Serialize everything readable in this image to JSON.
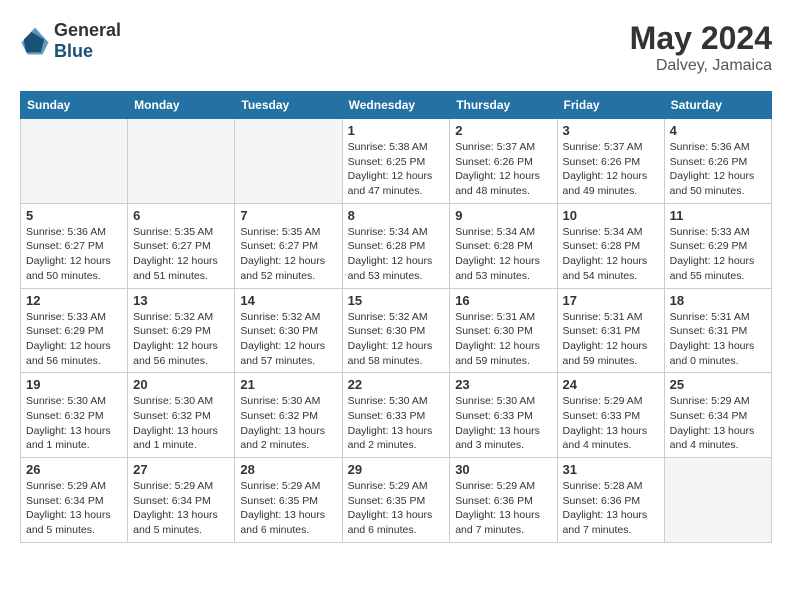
{
  "header": {
    "logo_general": "General",
    "logo_blue": "Blue",
    "month_year": "May 2024",
    "location": "Dalvey, Jamaica"
  },
  "weekdays": [
    "Sunday",
    "Monday",
    "Tuesday",
    "Wednesday",
    "Thursday",
    "Friday",
    "Saturday"
  ],
  "weeks": [
    [
      {
        "day": "",
        "info": ""
      },
      {
        "day": "",
        "info": ""
      },
      {
        "day": "",
        "info": ""
      },
      {
        "day": "1",
        "info": "Sunrise: 5:38 AM\nSunset: 6:25 PM\nDaylight: 12 hours\nand 47 minutes."
      },
      {
        "day": "2",
        "info": "Sunrise: 5:37 AM\nSunset: 6:26 PM\nDaylight: 12 hours\nand 48 minutes."
      },
      {
        "day": "3",
        "info": "Sunrise: 5:37 AM\nSunset: 6:26 PM\nDaylight: 12 hours\nand 49 minutes."
      },
      {
        "day": "4",
        "info": "Sunrise: 5:36 AM\nSunset: 6:26 PM\nDaylight: 12 hours\nand 50 minutes."
      }
    ],
    [
      {
        "day": "5",
        "info": "Sunrise: 5:36 AM\nSunset: 6:27 PM\nDaylight: 12 hours\nand 50 minutes."
      },
      {
        "day": "6",
        "info": "Sunrise: 5:35 AM\nSunset: 6:27 PM\nDaylight: 12 hours\nand 51 minutes."
      },
      {
        "day": "7",
        "info": "Sunrise: 5:35 AM\nSunset: 6:27 PM\nDaylight: 12 hours\nand 52 minutes."
      },
      {
        "day": "8",
        "info": "Sunrise: 5:34 AM\nSunset: 6:28 PM\nDaylight: 12 hours\nand 53 minutes."
      },
      {
        "day": "9",
        "info": "Sunrise: 5:34 AM\nSunset: 6:28 PM\nDaylight: 12 hours\nand 53 minutes."
      },
      {
        "day": "10",
        "info": "Sunrise: 5:34 AM\nSunset: 6:28 PM\nDaylight: 12 hours\nand 54 minutes."
      },
      {
        "day": "11",
        "info": "Sunrise: 5:33 AM\nSunset: 6:29 PM\nDaylight: 12 hours\nand 55 minutes."
      }
    ],
    [
      {
        "day": "12",
        "info": "Sunrise: 5:33 AM\nSunset: 6:29 PM\nDaylight: 12 hours\nand 56 minutes."
      },
      {
        "day": "13",
        "info": "Sunrise: 5:32 AM\nSunset: 6:29 PM\nDaylight: 12 hours\nand 56 minutes."
      },
      {
        "day": "14",
        "info": "Sunrise: 5:32 AM\nSunset: 6:30 PM\nDaylight: 12 hours\nand 57 minutes."
      },
      {
        "day": "15",
        "info": "Sunrise: 5:32 AM\nSunset: 6:30 PM\nDaylight: 12 hours\nand 58 minutes."
      },
      {
        "day": "16",
        "info": "Sunrise: 5:31 AM\nSunset: 6:30 PM\nDaylight: 12 hours\nand 59 minutes."
      },
      {
        "day": "17",
        "info": "Sunrise: 5:31 AM\nSunset: 6:31 PM\nDaylight: 12 hours\nand 59 minutes."
      },
      {
        "day": "18",
        "info": "Sunrise: 5:31 AM\nSunset: 6:31 PM\nDaylight: 13 hours\nand 0 minutes."
      }
    ],
    [
      {
        "day": "19",
        "info": "Sunrise: 5:30 AM\nSunset: 6:32 PM\nDaylight: 13 hours\nand 1 minute."
      },
      {
        "day": "20",
        "info": "Sunrise: 5:30 AM\nSunset: 6:32 PM\nDaylight: 13 hours\nand 1 minute."
      },
      {
        "day": "21",
        "info": "Sunrise: 5:30 AM\nSunset: 6:32 PM\nDaylight: 13 hours\nand 2 minutes."
      },
      {
        "day": "22",
        "info": "Sunrise: 5:30 AM\nSunset: 6:33 PM\nDaylight: 13 hours\nand 2 minutes."
      },
      {
        "day": "23",
        "info": "Sunrise: 5:30 AM\nSunset: 6:33 PM\nDaylight: 13 hours\nand 3 minutes."
      },
      {
        "day": "24",
        "info": "Sunrise: 5:29 AM\nSunset: 6:33 PM\nDaylight: 13 hours\nand 4 minutes."
      },
      {
        "day": "25",
        "info": "Sunrise: 5:29 AM\nSunset: 6:34 PM\nDaylight: 13 hours\nand 4 minutes."
      }
    ],
    [
      {
        "day": "26",
        "info": "Sunrise: 5:29 AM\nSunset: 6:34 PM\nDaylight: 13 hours\nand 5 minutes."
      },
      {
        "day": "27",
        "info": "Sunrise: 5:29 AM\nSunset: 6:34 PM\nDaylight: 13 hours\nand 5 minutes."
      },
      {
        "day": "28",
        "info": "Sunrise: 5:29 AM\nSunset: 6:35 PM\nDaylight: 13 hours\nand 6 minutes."
      },
      {
        "day": "29",
        "info": "Sunrise: 5:29 AM\nSunset: 6:35 PM\nDaylight: 13 hours\nand 6 minutes."
      },
      {
        "day": "30",
        "info": "Sunrise: 5:29 AM\nSunset: 6:36 PM\nDaylight: 13 hours\nand 7 minutes."
      },
      {
        "day": "31",
        "info": "Sunrise: 5:28 AM\nSunset: 6:36 PM\nDaylight: 13 hours\nand 7 minutes."
      },
      {
        "day": "",
        "info": ""
      }
    ]
  ]
}
